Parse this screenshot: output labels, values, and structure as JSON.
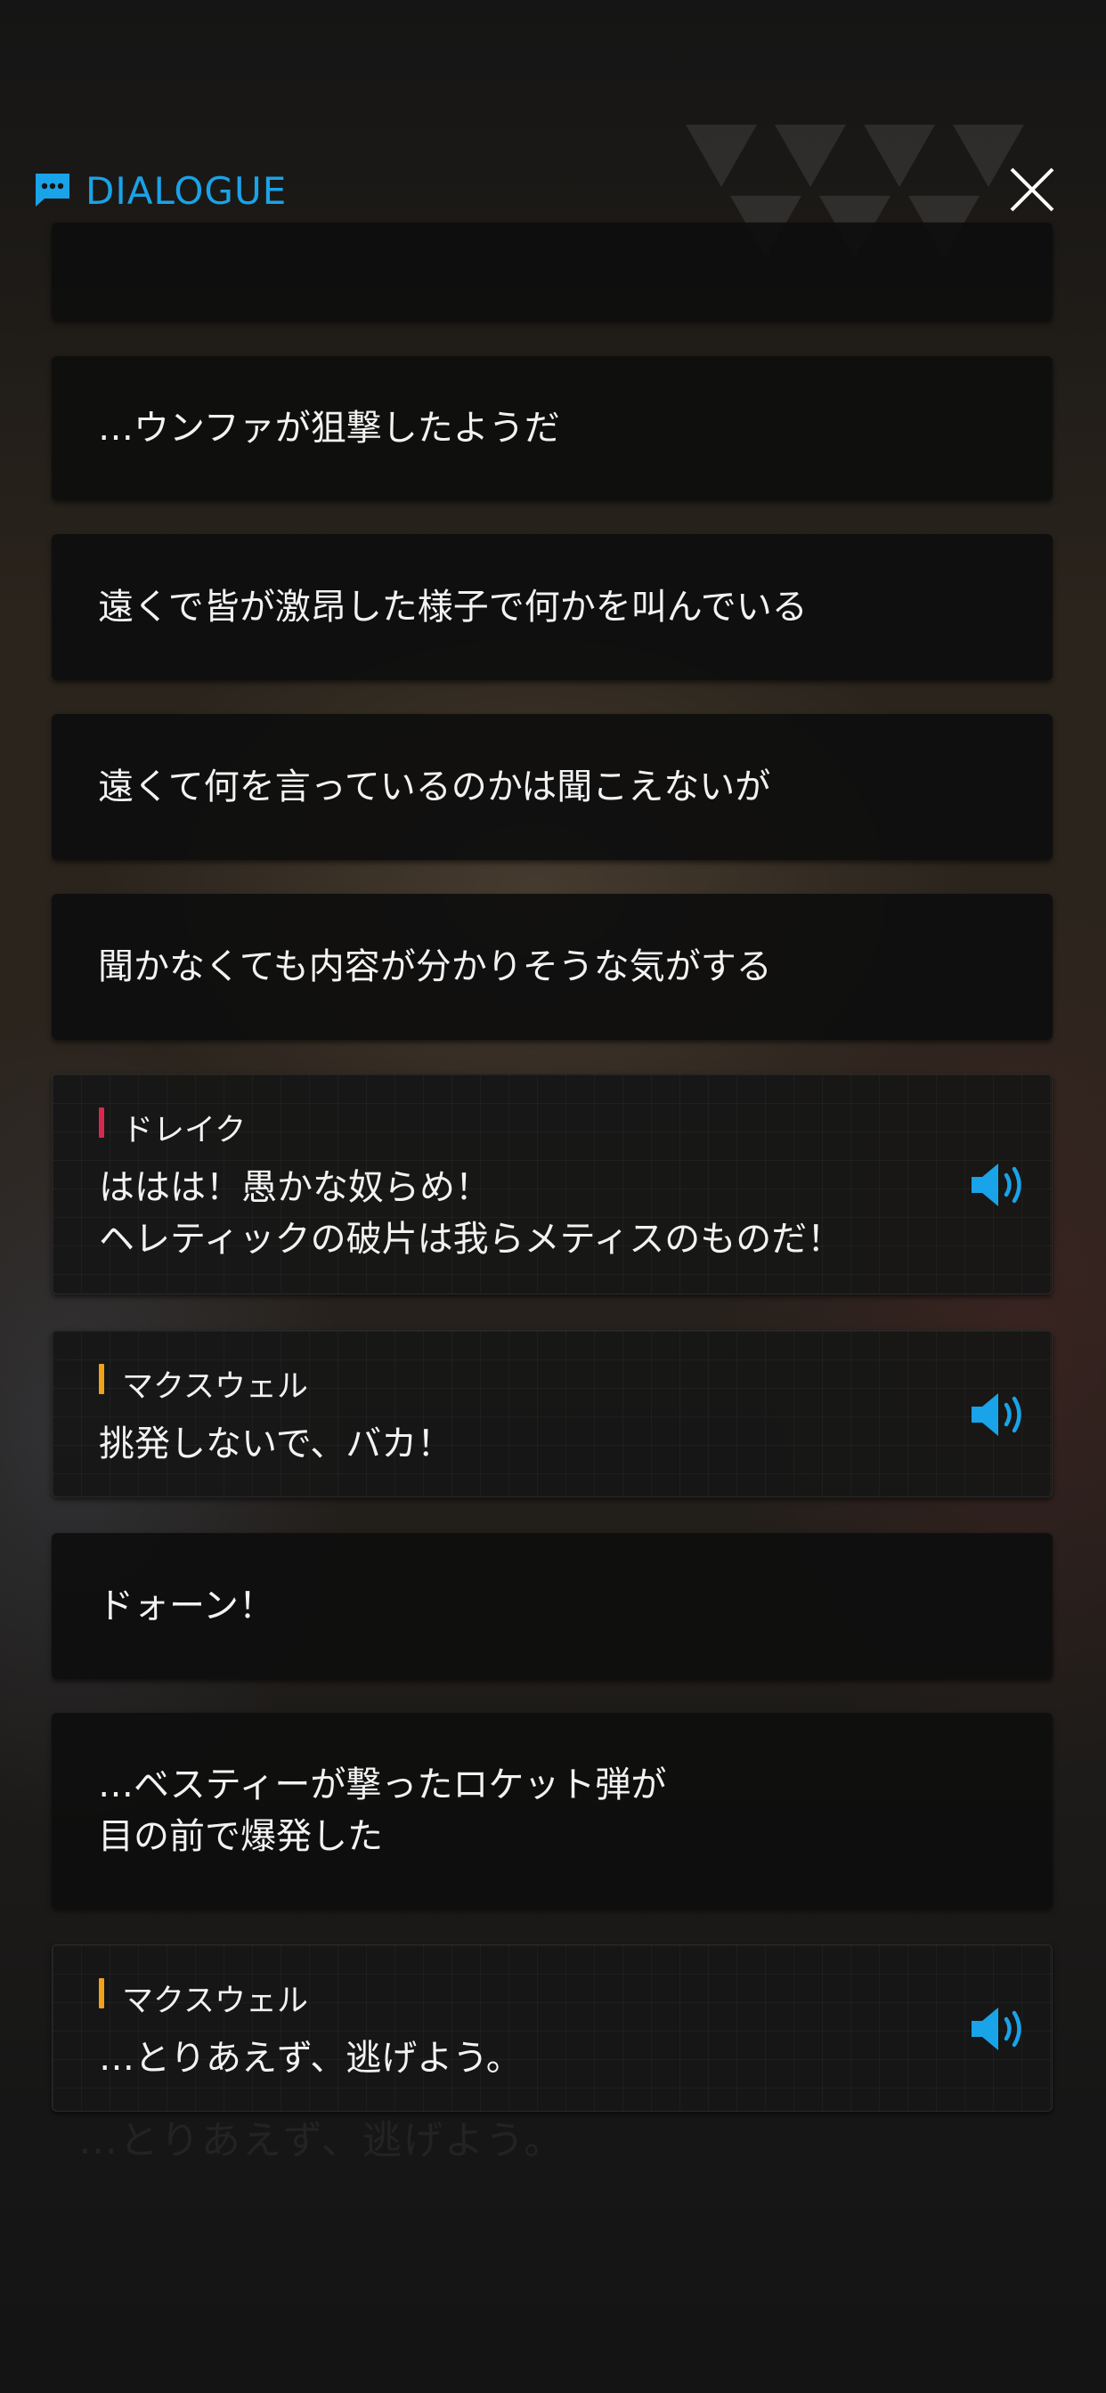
{
  "header": {
    "title": "DIALOGUE"
  },
  "colors": {
    "accent": "#19a3e8",
    "speaker_drake": "#d8284f",
    "speaker_maxwell": "#f0a21a"
  },
  "icons": {
    "header": "chat-bubble-icon",
    "close": "close-icon",
    "voice": "speaker-volume-icon"
  },
  "entries": [
    {
      "type": "narration",
      "text": ""
    },
    {
      "type": "narration",
      "text": "…ウンファが狙撃したようだ"
    },
    {
      "type": "narration",
      "text": "遠くで皆が激昂した様子で何かを叫んでいる"
    },
    {
      "type": "narration",
      "text": "遠くて何を言っているのかは聞こえないが"
    },
    {
      "type": "narration",
      "text": "聞かなくても内容が分かりそうな気がする"
    },
    {
      "type": "speech",
      "speaker": "ドレイク",
      "text": "ははは！愚かな奴らめ！\nヘレティックの破片は我らメティスのものだ！",
      "voice": true
    },
    {
      "type": "speech",
      "speaker": "マクスウェル",
      "text": "挑発しないで、バカ！",
      "voice": true
    },
    {
      "type": "narration",
      "text": "ドォーン！"
    },
    {
      "type": "narration",
      "text": "…ベスティーが撃ったロケット弾が\n目の前で爆発した"
    },
    {
      "type": "speech",
      "speaker": "マクスウェル",
      "text": "…とりあえず、逃げよう。",
      "voice": true
    }
  ],
  "background_caption": "…とりあえず、逃げよう。"
}
